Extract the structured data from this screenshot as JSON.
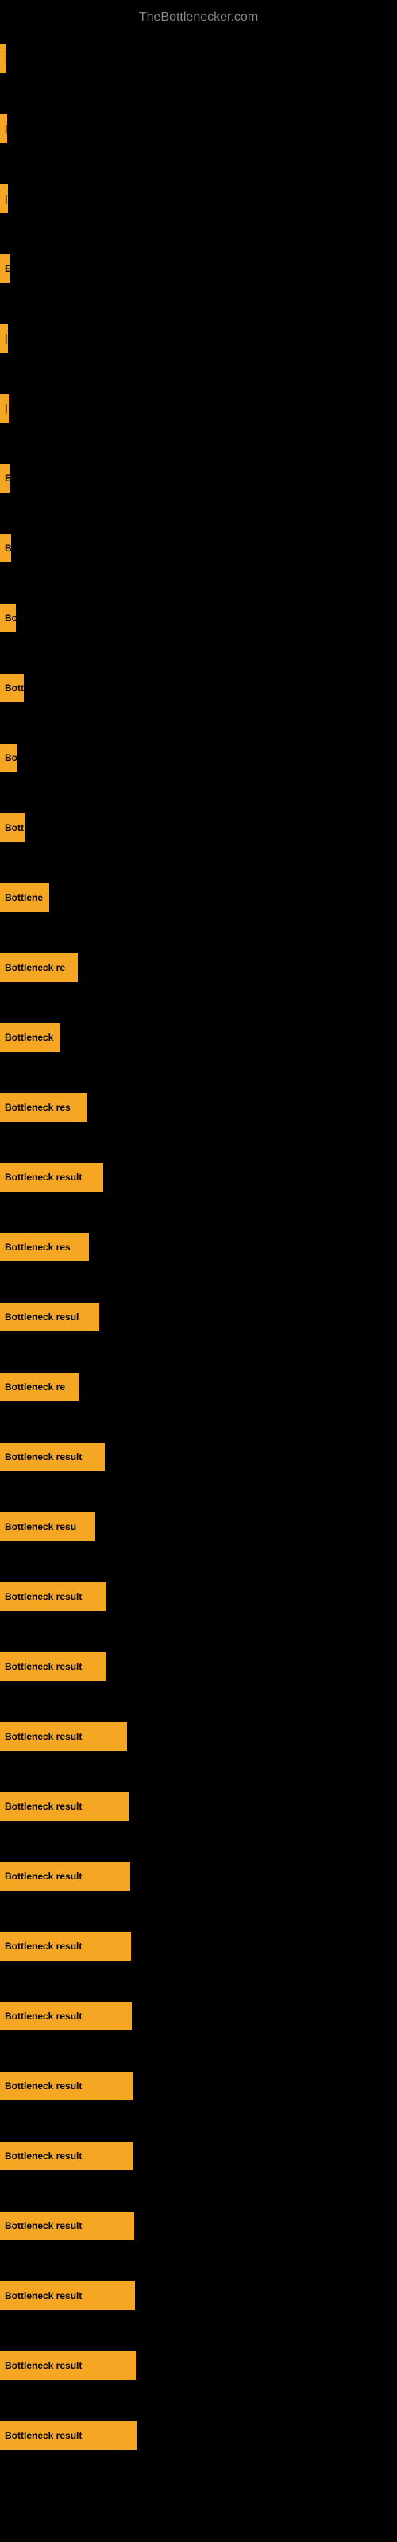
{
  "site": {
    "title": "TheBottlenecker.com"
  },
  "bars": [
    {
      "id": 1,
      "label": "|",
      "width": 8
    },
    {
      "id": 2,
      "label": "|",
      "width": 9
    },
    {
      "id": 3,
      "label": "|",
      "width": 10
    },
    {
      "id": 4,
      "label": "E",
      "width": 12
    },
    {
      "id": 5,
      "label": "|",
      "width": 10
    },
    {
      "id": 6,
      "label": "|",
      "width": 11
    },
    {
      "id": 7,
      "label": "E",
      "width": 12
    },
    {
      "id": 8,
      "label": "B",
      "width": 14
    },
    {
      "id": 9,
      "label": "Bo",
      "width": 20
    },
    {
      "id": 10,
      "label": "Bott",
      "width": 30
    },
    {
      "id": 11,
      "label": "Bo",
      "width": 22
    },
    {
      "id": 12,
      "label": "Bott",
      "width": 32
    },
    {
      "id": 13,
      "label": "Bottlene",
      "width": 62
    },
    {
      "id": 14,
      "label": "Bottleneck re",
      "width": 98
    },
    {
      "id": 15,
      "label": "Bottleneck",
      "width": 75
    },
    {
      "id": 16,
      "label": "Bottleneck res",
      "width": 110
    },
    {
      "id": 17,
      "label": "Bottleneck result",
      "width": 130
    },
    {
      "id": 18,
      "label": "Bottleneck res",
      "width": 112
    },
    {
      "id": 19,
      "label": "Bottleneck resul",
      "width": 125
    },
    {
      "id": 20,
      "label": "Bottleneck re",
      "width": 100
    },
    {
      "id": 21,
      "label": "Bottleneck result",
      "width": 132
    },
    {
      "id": 22,
      "label": "Bottleneck resu",
      "width": 120
    },
    {
      "id": 23,
      "label": "Bottleneck result",
      "width": 133
    },
    {
      "id": 24,
      "label": "Bottleneck result",
      "width": 134
    },
    {
      "id": 25,
      "label": "Bottleneck result",
      "width": 160
    },
    {
      "id": 26,
      "label": "Bottleneck result",
      "width": 162
    },
    {
      "id": 27,
      "label": "Bottleneck result",
      "width": 164
    },
    {
      "id": 28,
      "label": "Bottleneck result",
      "width": 165
    },
    {
      "id": 29,
      "label": "Bottleneck result",
      "width": 166
    },
    {
      "id": 30,
      "label": "Bottleneck result",
      "width": 167
    },
    {
      "id": 31,
      "label": "Bottleneck result",
      "width": 168
    },
    {
      "id": 32,
      "label": "Bottleneck result",
      "width": 169
    },
    {
      "id": 33,
      "label": "Bottleneck result",
      "width": 170
    },
    {
      "id": 34,
      "label": "Bottleneck result",
      "width": 171
    },
    {
      "id": 35,
      "label": "Bottleneck result",
      "width": 172
    }
  ]
}
